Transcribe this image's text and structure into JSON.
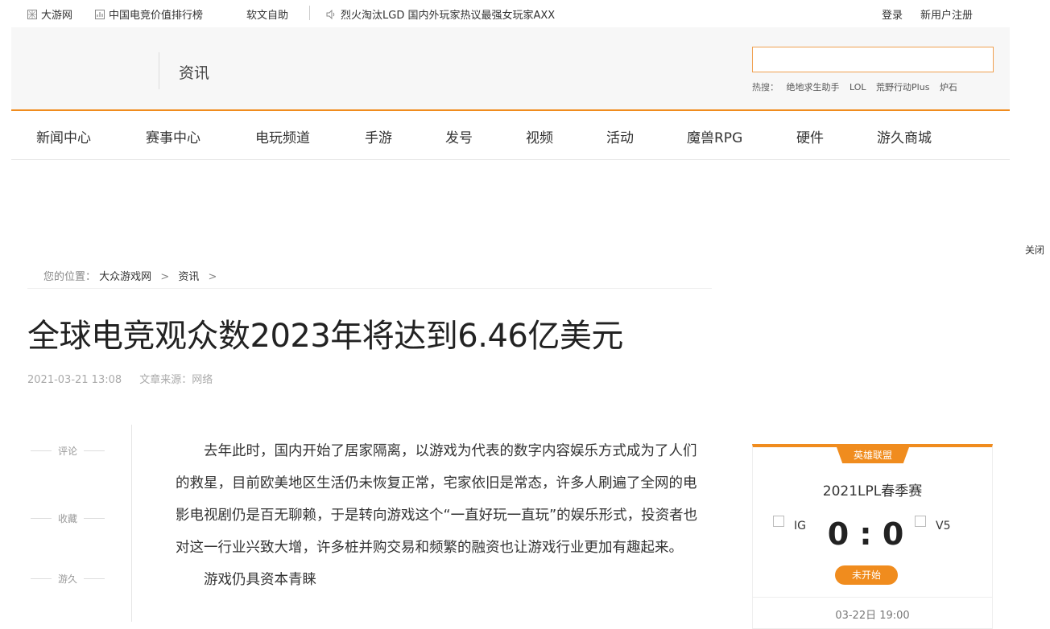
{
  "topbar": {
    "site": "大游网",
    "rank": "中国电竞价值排行榜",
    "selfhelp": "软文自助",
    "headline": "烈火淘汰LGD 国内外玩家热议最强女玩家AXX",
    "login": "登录",
    "register": "新用户注册"
  },
  "header": {
    "section": "资讯",
    "search_value": "",
    "hot_label": "热搜：",
    "hot_terms": [
      "绝地求生助手",
      "LOL",
      "荒野行动Plus",
      "炉石"
    ]
  },
  "nav": [
    "新闻中心",
    "赛事中心",
    "电玩频道",
    "手游",
    "发号",
    "视频",
    "活动",
    "魔兽RPG",
    "硬件",
    "游久商城"
  ],
  "close": "关闭",
  "breadcrumb": {
    "label": "您的位置：",
    "home": "大众游戏网",
    "sep": ">",
    "section": "资讯"
  },
  "article": {
    "title": "全球电竞观众数2023年将达到6.46亿美元",
    "date": "2021-03-21 13:08",
    "source": "文章来源：网络",
    "para1": "去年此时，国内开始了居家隔离，以游戏为代表的数字内容娱乐方式成为了人们的救星，目前欧美地区生活仍未恢复正常，宅家依旧是常态，许多人刷遍了全网的电影电视剧仍是百无聊赖，于是转向游戏这个“一直好玩一直玩”的娱乐形式，投资者也对这一行业兴致大增，许多桩并购交易和频繁的融资也让游戏行业更加有趣起来。",
    "para2": "游戏仍具资本青睐"
  },
  "tools": [
    "评论",
    "收藏",
    "游久"
  ],
  "match": {
    "tag": "英雄联盟",
    "event": "2021LPL春季赛",
    "team1": "IG",
    "team2": "V5",
    "score": "0 : 0",
    "status": "未开始",
    "time": "03-22日 19:00"
  },
  "colors": {
    "accent": "#f08c1e"
  }
}
